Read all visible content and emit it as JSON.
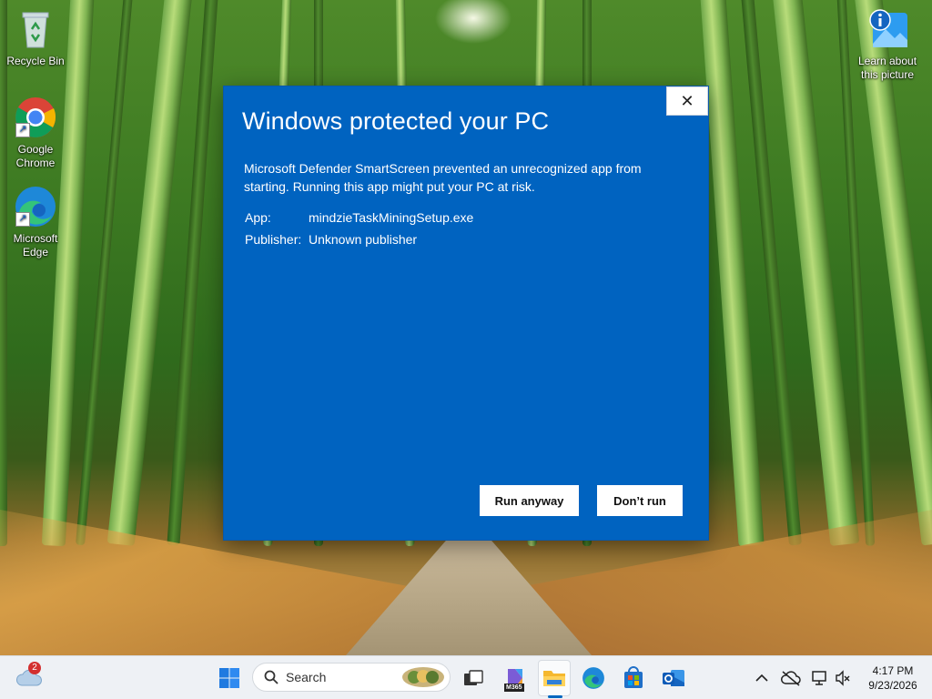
{
  "desktop": {
    "icons": [
      {
        "label": "Recycle Bin",
        "icon": "recycle-bin-icon"
      },
      {
        "label": "Google Chrome",
        "icon": "chrome-icon"
      },
      {
        "label": "Microsoft Edge",
        "icon": "edge-icon"
      },
      {
        "label": "Learn about this picture",
        "icon": "info-picture-icon"
      }
    ]
  },
  "dialog": {
    "title": "Windows protected your PC",
    "message": "Microsoft Defender SmartScreen prevented an unrecognized app from starting. Running this app might put your PC at risk.",
    "app_label": "App:",
    "app_value": "mindzieTaskMiningSetup.exe",
    "publisher_label": "Publisher:",
    "publisher_value": "Unknown publisher",
    "run_anyway_label": "Run anyway",
    "dont_run_label": "Don’t run",
    "close_glyph": "✕",
    "background": "#0063c0"
  },
  "taskbar": {
    "weather_badge": "2",
    "search_placeholder": "Search",
    "m365_label": "M365",
    "time": "4:17 PM",
    "date": "9/23/2026"
  }
}
